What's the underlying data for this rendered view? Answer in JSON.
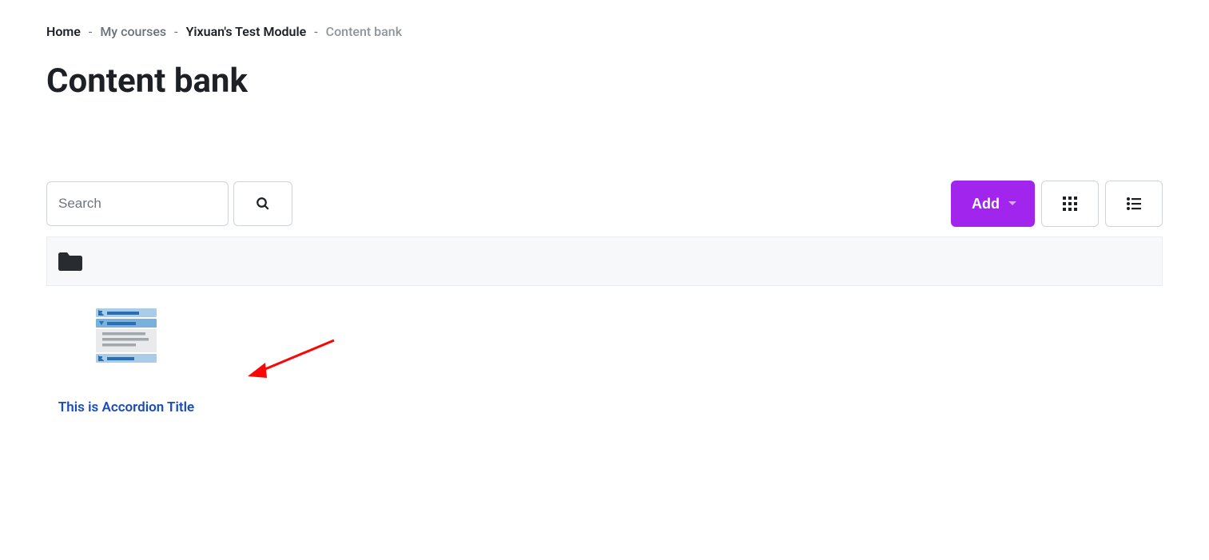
{
  "breadcrumb": {
    "home": "Home",
    "mycourses": "My courses",
    "module": "Yixuan's Test Module",
    "current": "Content bank"
  },
  "page": {
    "title": "Content bank"
  },
  "search": {
    "placeholder": "Search"
  },
  "buttons": {
    "add": "Add"
  },
  "items": [
    {
      "title": "This is Accordion Title"
    }
  ]
}
